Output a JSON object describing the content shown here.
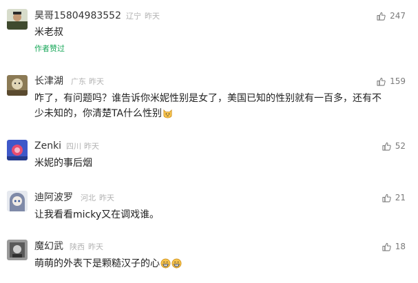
{
  "comments": [
    {
      "name": "昊哥15804983552",
      "location": "辽宁",
      "time": "昨天",
      "likes": "247",
      "text": "米老叔",
      "author_badge": "作者赞过"
    },
    {
      "name": "长津湖",
      "location": "广东",
      "time": "昨天",
      "likes": "159",
      "text_line1": "咋了，有问题吗？谁告诉你米妮性别是女了，美国已知的性别就有一百多，还有不",
      "text_line2": "少未知的，你清楚TA什么性别"
    },
    {
      "name": "Zenki",
      "location": "四川",
      "time": "昨天",
      "likes": "52",
      "text": "米妮的事后烟"
    },
    {
      "name": "迪阿波罗",
      "location": "河北",
      "time": "昨天",
      "likes": "21",
      "text": "让我看看micky又在调戏谁。"
    },
    {
      "name": "魔幻武",
      "location": "陕西",
      "time": "昨天",
      "likes": "18",
      "text": "萌萌的外表下是颗糙汉子的心"
    }
  ],
  "colors": {
    "author_badge": "#19a85a",
    "meta": "#b2b2b2",
    "like": "#7a7a7a"
  },
  "icons": {
    "like": "thumbs-up-icon",
    "emoji_cat": "cat-emoji-icon",
    "emoji_grin": "grinning-emoji-icon"
  }
}
